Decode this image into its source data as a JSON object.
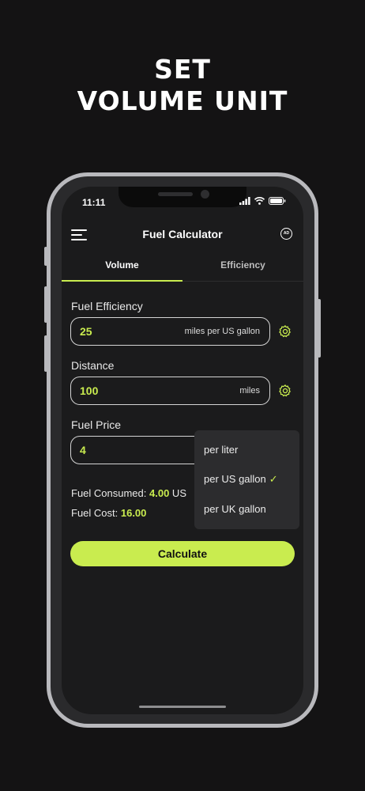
{
  "headline": {
    "line1": "SET",
    "line2": "VOLUME UNIT"
  },
  "status_bar": {
    "time": "11:11"
  },
  "app_bar": {
    "title": "Fuel Calculator",
    "ad_label": "AD"
  },
  "tabs": [
    {
      "label": "Volume",
      "selected": true
    },
    {
      "label": "Efficiency",
      "selected": false
    }
  ],
  "fuel_efficiency": {
    "label": "Fuel Efficiency",
    "value": "25",
    "unit": "miles per US gallon"
  },
  "distance": {
    "label": "Distance",
    "value": "100",
    "unit": "miles"
  },
  "fuel_price": {
    "label": "Fuel Price",
    "value": "4"
  },
  "results": {
    "consumed_label": "Fuel Consumed: ",
    "consumed_value": "4.00",
    "consumed_unit": " US",
    "cost_label": "Fuel Cost: ",
    "cost_value": "16.00"
  },
  "dropdown": {
    "options": [
      "per liter",
      "per US gallon",
      "per UK gallon"
    ],
    "selected": "per US gallon",
    "check": "✓"
  },
  "calculate_label": "Calculate",
  "colors": {
    "accent": "#c9ec4f",
    "background": "#141314",
    "screen": "#1b1b1c",
    "menu": "#2c2c2e"
  }
}
